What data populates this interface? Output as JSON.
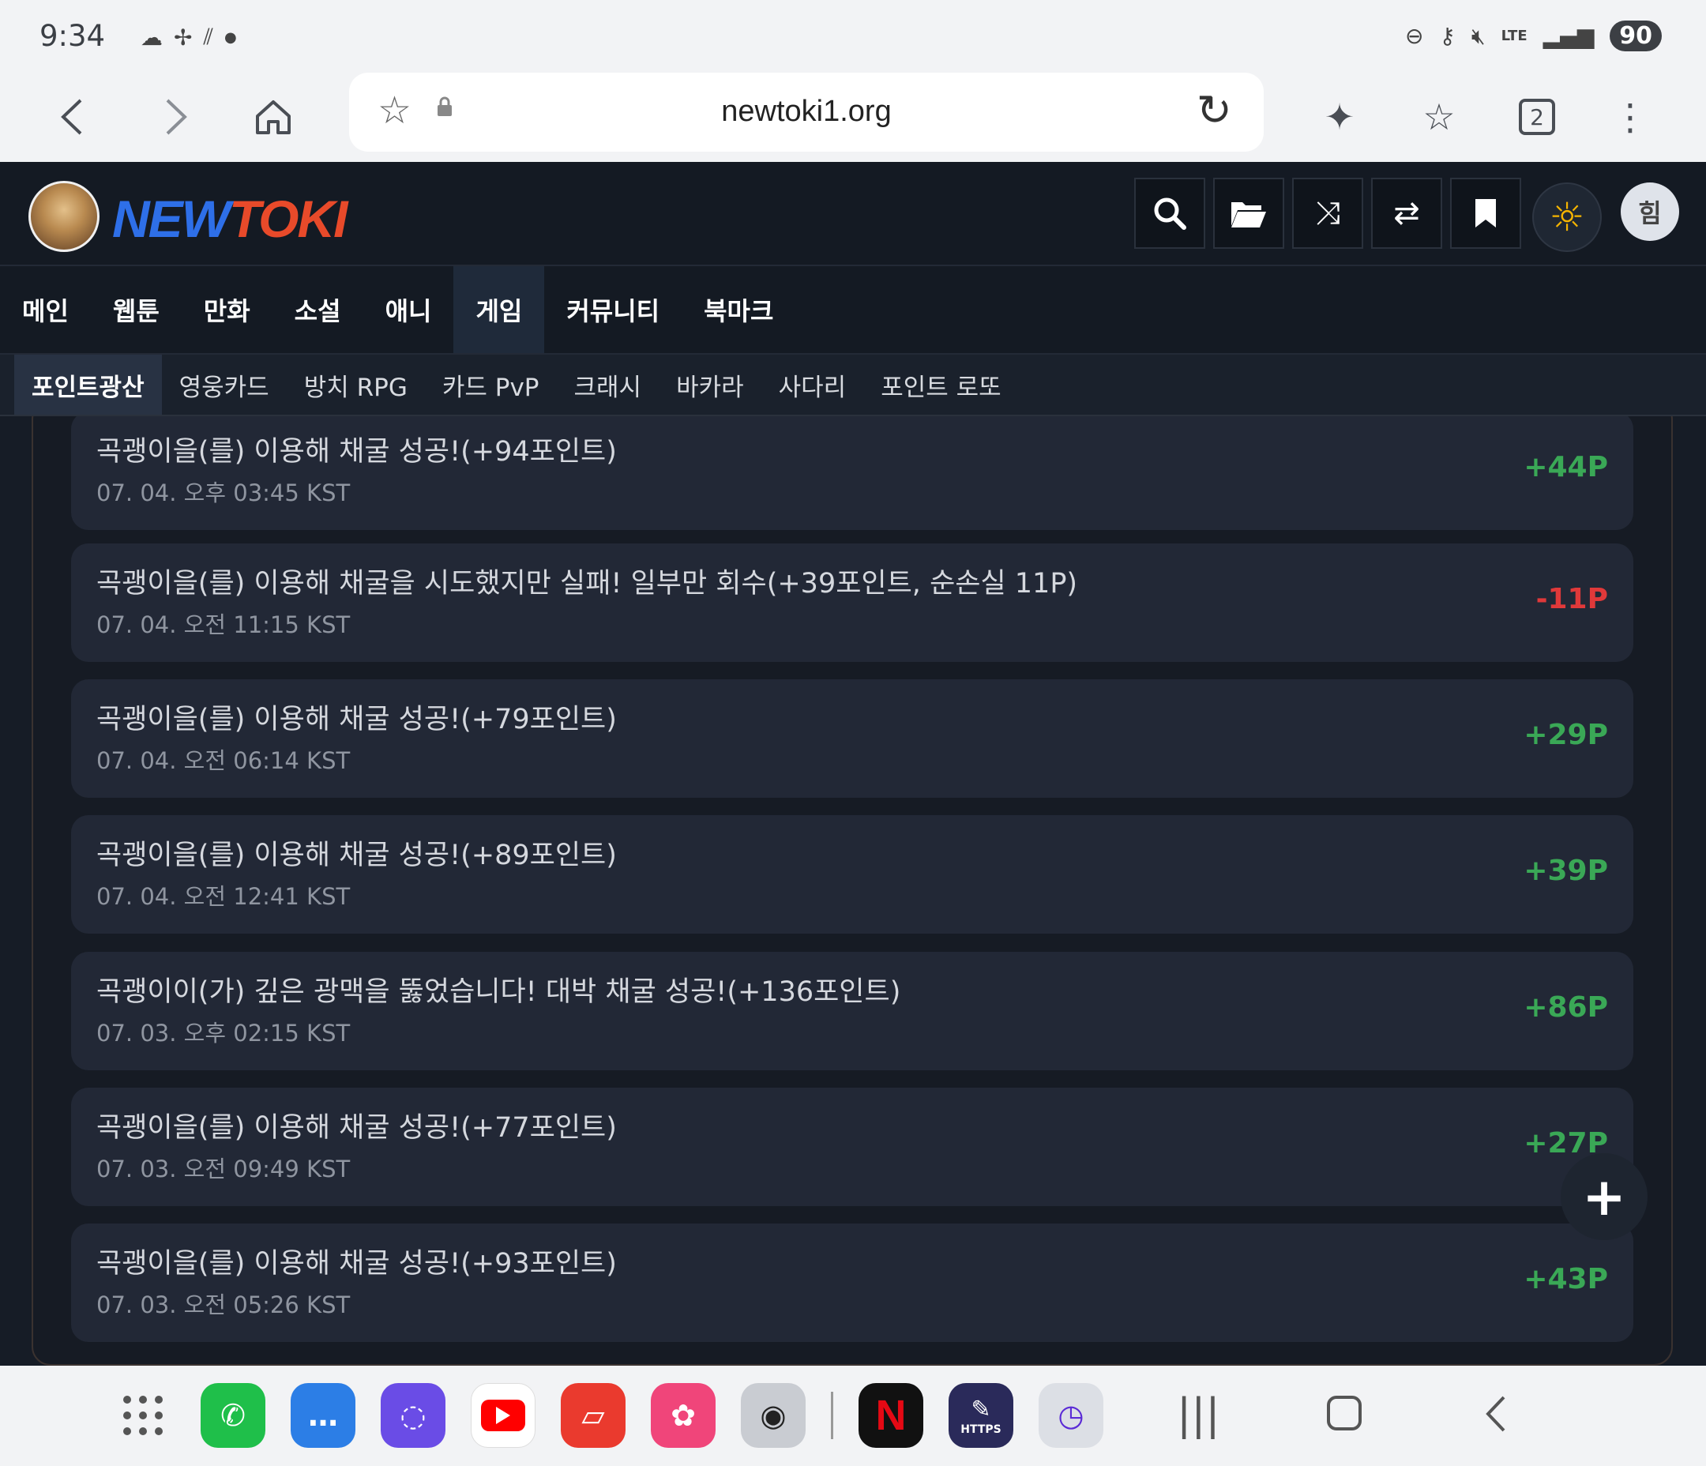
{
  "status_bar": {
    "time": "9:34",
    "network": "LTE",
    "battery": "90"
  },
  "browser": {
    "url": "newtoki1.org",
    "tab_count": "2"
  },
  "site": {
    "logo_part1": "NEW",
    "logo_part2": "TOKI",
    "user_initial": "힘"
  },
  "main_nav": [
    {
      "label": "메인",
      "active": false
    },
    {
      "label": "웹툰",
      "active": false
    },
    {
      "label": "만화",
      "active": false
    },
    {
      "label": "소설",
      "active": false
    },
    {
      "label": "애니",
      "active": false
    },
    {
      "label": "게임",
      "active": true
    },
    {
      "label": "커뮤니티",
      "active": false
    },
    {
      "label": "북마크",
      "active": false
    }
  ],
  "sub_nav": [
    {
      "label": "포인트광산",
      "active": true
    },
    {
      "label": "영웅카드",
      "active": false
    },
    {
      "label": "방치 RPG",
      "active": false
    },
    {
      "label": "카드 PvP",
      "active": false
    },
    {
      "label": "크래시",
      "active": false
    },
    {
      "label": "바카라",
      "active": false
    },
    {
      "label": "사다리",
      "active": false
    },
    {
      "label": "포인트 로또",
      "active": false
    }
  ],
  "history": [
    {
      "desc": "곡괭이을(를) 이용해 채굴 성공!(+94포인트)",
      "date": "07. 04. 오후 03:45 KST",
      "points": "+44P",
      "positive": true
    },
    {
      "desc": "곡괭이을(를) 이용해 채굴을 시도했지만 실패! 일부만 회수(+39포인트, 순손실 11P)",
      "date": "07. 04. 오전 11:15 KST",
      "points": "-11P",
      "positive": false
    },
    {
      "desc": "곡괭이을(를) 이용해 채굴 성공!(+79포인트)",
      "date": "07. 04. 오전 06:14 KST",
      "points": "+29P",
      "positive": true
    },
    {
      "desc": "곡괭이을(를) 이용해 채굴 성공!(+89포인트)",
      "date": "07. 04. 오전 12:41 KST",
      "points": "+39P",
      "positive": true
    },
    {
      "desc": "곡괭이이(가) 깊은 광맥을 뚫었습니다! 대박 채굴 성공!(+136포인트)",
      "date": "07. 03. 오후 02:15 KST",
      "points": "+86P",
      "positive": true
    },
    {
      "desc": "곡괭이을(를) 이용해 채굴 성공!(+77포인트)",
      "date": "07. 03. 오전 09:49 KST",
      "points": "+27P",
      "positive": true
    },
    {
      "desc": "곡괭이을(를) 이용해 채굴 성공!(+93포인트)",
      "date": "07. 03. 오전 05:26 KST",
      "points": "+43P",
      "positive": true
    }
  ],
  "icons": {
    "header_buttons": [
      "search-icon",
      "folder-open-icon",
      "shuffle-icon",
      "swap-icon",
      "bookmark-icon"
    ],
    "theme": "sun-icon",
    "fab": "plus-icon"
  },
  "dock_apps": [
    {
      "name": "apps-grid"
    },
    {
      "name": "phone",
      "color": "#1fbf4a"
    },
    {
      "name": "messages",
      "color": "#2c7ee6"
    },
    {
      "name": "internet",
      "color": "#6a4ce6"
    },
    {
      "name": "youtube",
      "color": "#ffffff"
    },
    {
      "name": "notes",
      "color": "#ea3a2e"
    },
    {
      "name": "gallery",
      "color": "#f0457a"
    },
    {
      "name": "camera",
      "color": "#c9ccd2"
    },
    {
      "name": "netflix",
      "color": "#111111"
    },
    {
      "name": "https-app",
      "color": "#2a2a5a",
      "label": "HTTPS"
    },
    {
      "name": "clock",
      "color": "#dcdfe5"
    }
  ],
  "colors": {
    "positive": "#3aa856",
    "negative": "#e0393a",
    "active_tab_bg": "#1f2a3a"
  }
}
